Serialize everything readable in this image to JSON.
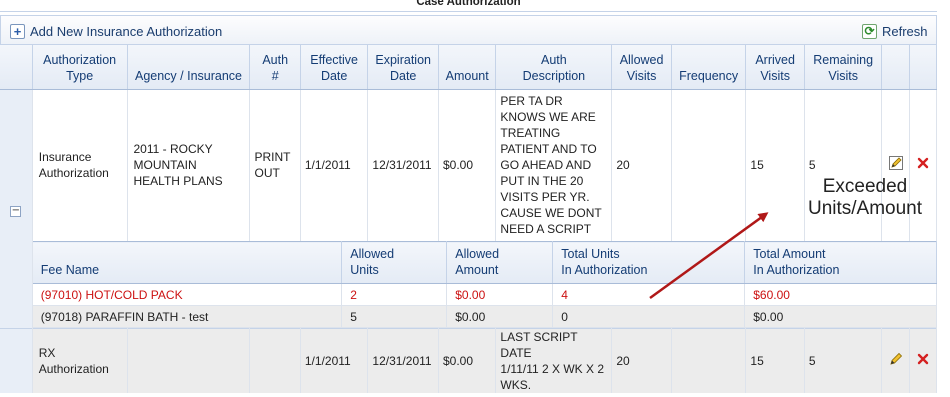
{
  "title": "Case Authorization",
  "toolbar": {
    "add_label": "Add New Insurance Authorization",
    "refresh_label": "Refresh"
  },
  "columns": {
    "auth_type": [
      "Authorization",
      "Type"
    ],
    "agency": "Agency / Insurance",
    "auth_no": [
      "Auth",
      "#"
    ],
    "effective": [
      "Effective",
      "Date"
    ],
    "expiration": [
      "Expiration",
      "Date"
    ],
    "amount": "Amount",
    "desc": [
      "Auth",
      "Description"
    ],
    "allowed": [
      "Allowed",
      "Visits"
    ],
    "frequency": "Frequency",
    "arrived": [
      "Arrived",
      "Visits"
    ],
    "remaining": [
      "Remaining",
      "Visits"
    ]
  },
  "rows": [
    {
      "expander": "−",
      "auth_type": [
        "Insurance",
        "Authorization"
      ],
      "agency": [
        "2011 - ROCKY",
        "MOUNTAIN",
        "HEALTH PLANS"
      ],
      "auth_no": [
        "PRINT",
        "OUT"
      ],
      "effective": "1/1/2011",
      "expiration": "12/31/2011",
      "amount": "$0.00",
      "desc": [
        "PER TA DR",
        "KNOWS WE ARE",
        "TREATING",
        "PATIENT AND TO",
        "GO AHEAD AND",
        "PUT IN THE 20",
        "VISITS PER YR.",
        "CAUSE WE DONT",
        "NEED A SCRIPT"
      ],
      "allowed": "20",
      "frequency": "",
      "arrived": "15",
      "remaining": "5"
    },
    {
      "auth_type": [
        "RX",
        "Authorization"
      ],
      "agency": "",
      "auth_no": "",
      "effective": "1/1/2011",
      "expiration": "12/31/2011",
      "amount": "$0.00",
      "desc": [
        "LAST SCRIPT DATE",
        "1/11/11 2 X WK X 2",
        "WKS."
      ],
      "allowed": "20",
      "frequency": "",
      "arrived": "15",
      "remaining": "5"
    }
  ],
  "fees": {
    "headers": {
      "fee_name": "Fee Name",
      "allowed_units": [
        "Allowed",
        "Units"
      ],
      "allowed_amount": [
        "Allowed",
        "Amount"
      ],
      "total_units": [
        "Total Units",
        "In Authorization"
      ],
      "total_amount": [
        "Total Amount",
        "In Authorization"
      ]
    },
    "items": [
      {
        "name": "(97010) HOT/COLD PACK",
        "allowed_units": "2",
        "allowed_amount": "$0.00",
        "total_units": "4",
        "total_amount": "$60.00",
        "exceeded": true
      },
      {
        "name": "(97018) PARAFFIN BATH - test",
        "allowed_units": "5",
        "allowed_amount": "$0.00",
        "total_units": "0",
        "total_amount": "$0.00",
        "exceeded": false
      }
    ]
  },
  "annotation": [
    "Exceeded",
    "Units/Amount"
  ],
  "colors": {
    "header_text": "#143c74",
    "alert_red": "#cc1111",
    "arrow_red": "#b01818"
  },
  "icons": [
    "add-icon",
    "refresh-icon",
    "collapse-icon",
    "edit-icon",
    "delete-icon"
  ]
}
